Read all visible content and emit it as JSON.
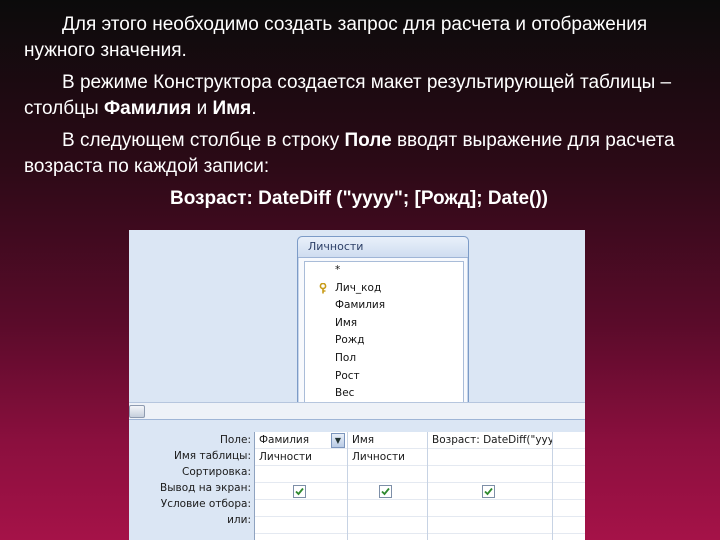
{
  "text": {
    "p1": "Для этого необходимо создать запрос для расчета и отображения нужного значения.",
    "p2_a": "В режиме Конструктора создается макет результирующей таблицы – столбцы ",
    "p2_b": "Фамилия",
    "p2_c": " и ",
    "p2_d": "Имя",
    "p2_e": ".",
    "p3_a": "В следующем столбце в строку ",
    "p3_b": "Поле",
    "p3_c": " вводят выражение для расчета возраста по каждой записи:",
    "formula": "Возраст: DateDiff (\"yyyy\"; [Рожд]; Date())"
  },
  "designer": {
    "table_name": "Личности",
    "fields": [
      "*",
      "Лич_код",
      "Фамилия",
      "Имя",
      "Рожд",
      "Пол",
      "Рост",
      "Вес"
    ],
    "key_field_index": 1,
    "row_labels": [
      "Поле:",
      "Имя таблицы:",
      "Сортировка:",
      "Вывод на экран:",
      "Условие отбора:",
      "или:"
    ],
    "columns": [
      {
        "field": "Фамилия",
        "table": "Личности",
        "show": true
      },
      {
        "field": "Имя",
        "table": "Личности",
        "show": true
      },
      {
        "field": "Возраст: DateDiff(\"yyyy",
        "table": "",
        "show": true
      },
      {
        "field": "",
        "table": "",
        "show": false
      }
    ]
  },
  "colors": {
    "check": "#2f8a2f",
    "accent": "#a51248"
  }
}
